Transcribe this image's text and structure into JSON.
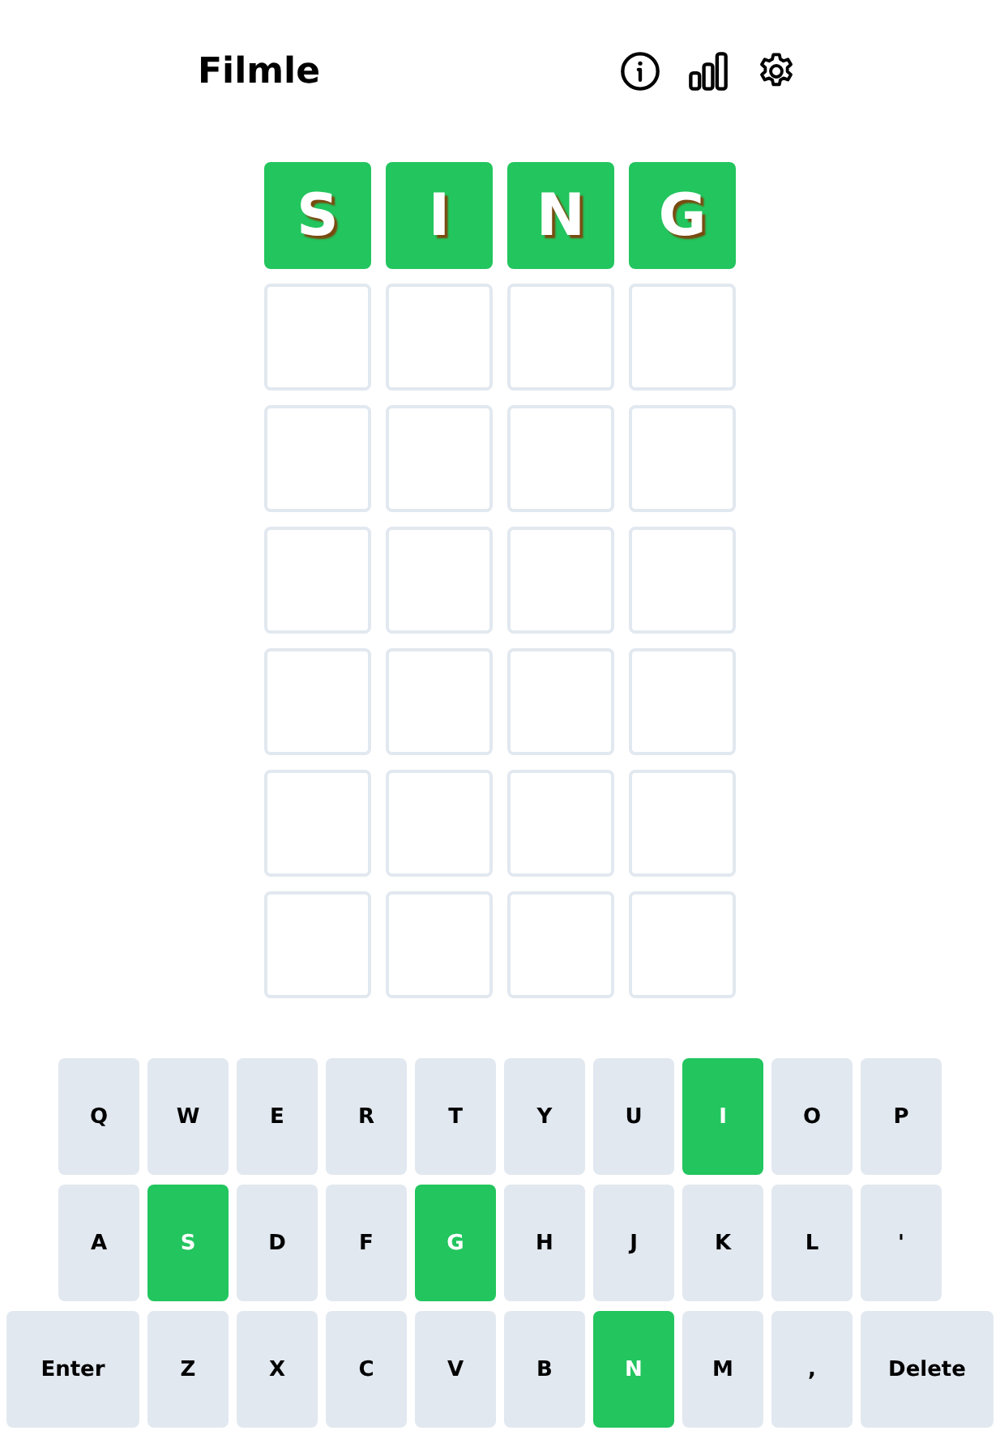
{
  "header": {
    "title": "Filmle"
  },
  "board": {
    "rows": [
      {
        "cells": [
          {
            "letter": "S",
            "correct": true
          },
          {
            "letter": "I",
            "correct": true
          },
          {
            "letter": "N",
            "correct": true
          },
          {
            "letter": "G",
            "correct": true
          }
        ]
      },
      {
        "cells": [
          {
            "correct": false
          },
          {
            "correct": false
          },
          {
            "correct": false
          },
          {
            "correct": false
          }
        ]
      },
      {
        "cells": [
          {
            "correct": false
          },
          {
            "correct": false
          },
          {
            "correct": false
          },
          {
            "correct": false
          }
        ]
      },
      {
        "cells": [
          {
            "correct": false
          },
          {
            "correct": false
          },
          {
            "correct": false
          },
          {
            "correct": false
          }
        ]
      },
      {
        "cells": [
          {
            "correct": false
          },
          {
            "correct": false
          },
          {
            "correct": false
          },
          {
            "correct": false
          }
        ]
      },
      {
        "cells": [
          {
            "correct": false
          },
          {
            "correct": false
          },
          {
            "correct": false
          },
          {
            "correct": false
          }
        ]
      },
      {
        "cells": [
          {
            "correct": false
          },
          {
            "correct": false
          },
          {
            "correct": false
          },
          {
            "correct": false
          }
        ]
      }
    ]
  },
  "keyboard": {
    "rows": [
      {
        "keys": [
          {
            "label": "Q",
            "correct": false
          },
          {
            "label": "W",
            "correct": false
          },
          {
            "label": "E",
            "correct": false
          },
          {
            "label": "R",
            "correct": false
          },
          {
            "label": "T",
            "correct": false
          },
          {
            "label": "Y",
            "correct": false
          },
          {
            "label": "U",
            "correct": false
          },
          {
            "label": "I",
            "correct": true
          },
          {
            "label": "O",
            "correct": false
          },
          {
            "label": "P",
            "correct": false
          }
        ]
      },
      {
        "keys": [
          {
            "label": "A",
            "correct": false
          },
          {
            "label": "S",
            "correct": true
          },
          {
            "label": "D",
            "correct": false
          },
          {
            "label": "F",
            "correct": false
          },
          {
            "label": "G",
            "correct": true
          },
          {
            "label": "H",
            "correct": false
          },
          {
            "label": "J",
            "correct": false
          },
          {
            "label": "K",
            "correct": false
          },
          {
            "label": "L",
            "correct": false
          },
          {
            "label": "'",
            "correct": false
          }
        ]
      },
      {
        "keys": [
          {
            "label": "Enter",
            "correct": false,
            "kind": "wide"
          },
          {
            "label": "Z",
            "correct": false
          },
          {
            "label": "X",
            "correct": false
          },
          {
            "label": "C",
            "correct": false
          },
          {
            "label": "V",
            "correct": false
          },
          {
            "label": "B",
            "correct": false
          },
          {
            "label": "N",
            "correct": true
          },
          {
            "label": "M",
            "correct": false
          },
          {
            "label": ",",
            "correct": false
          },
          {
            "label": "Delete",
            "correct": false,
            "kind": "wide"
          }
        ]
      }
    ]
  }
}
